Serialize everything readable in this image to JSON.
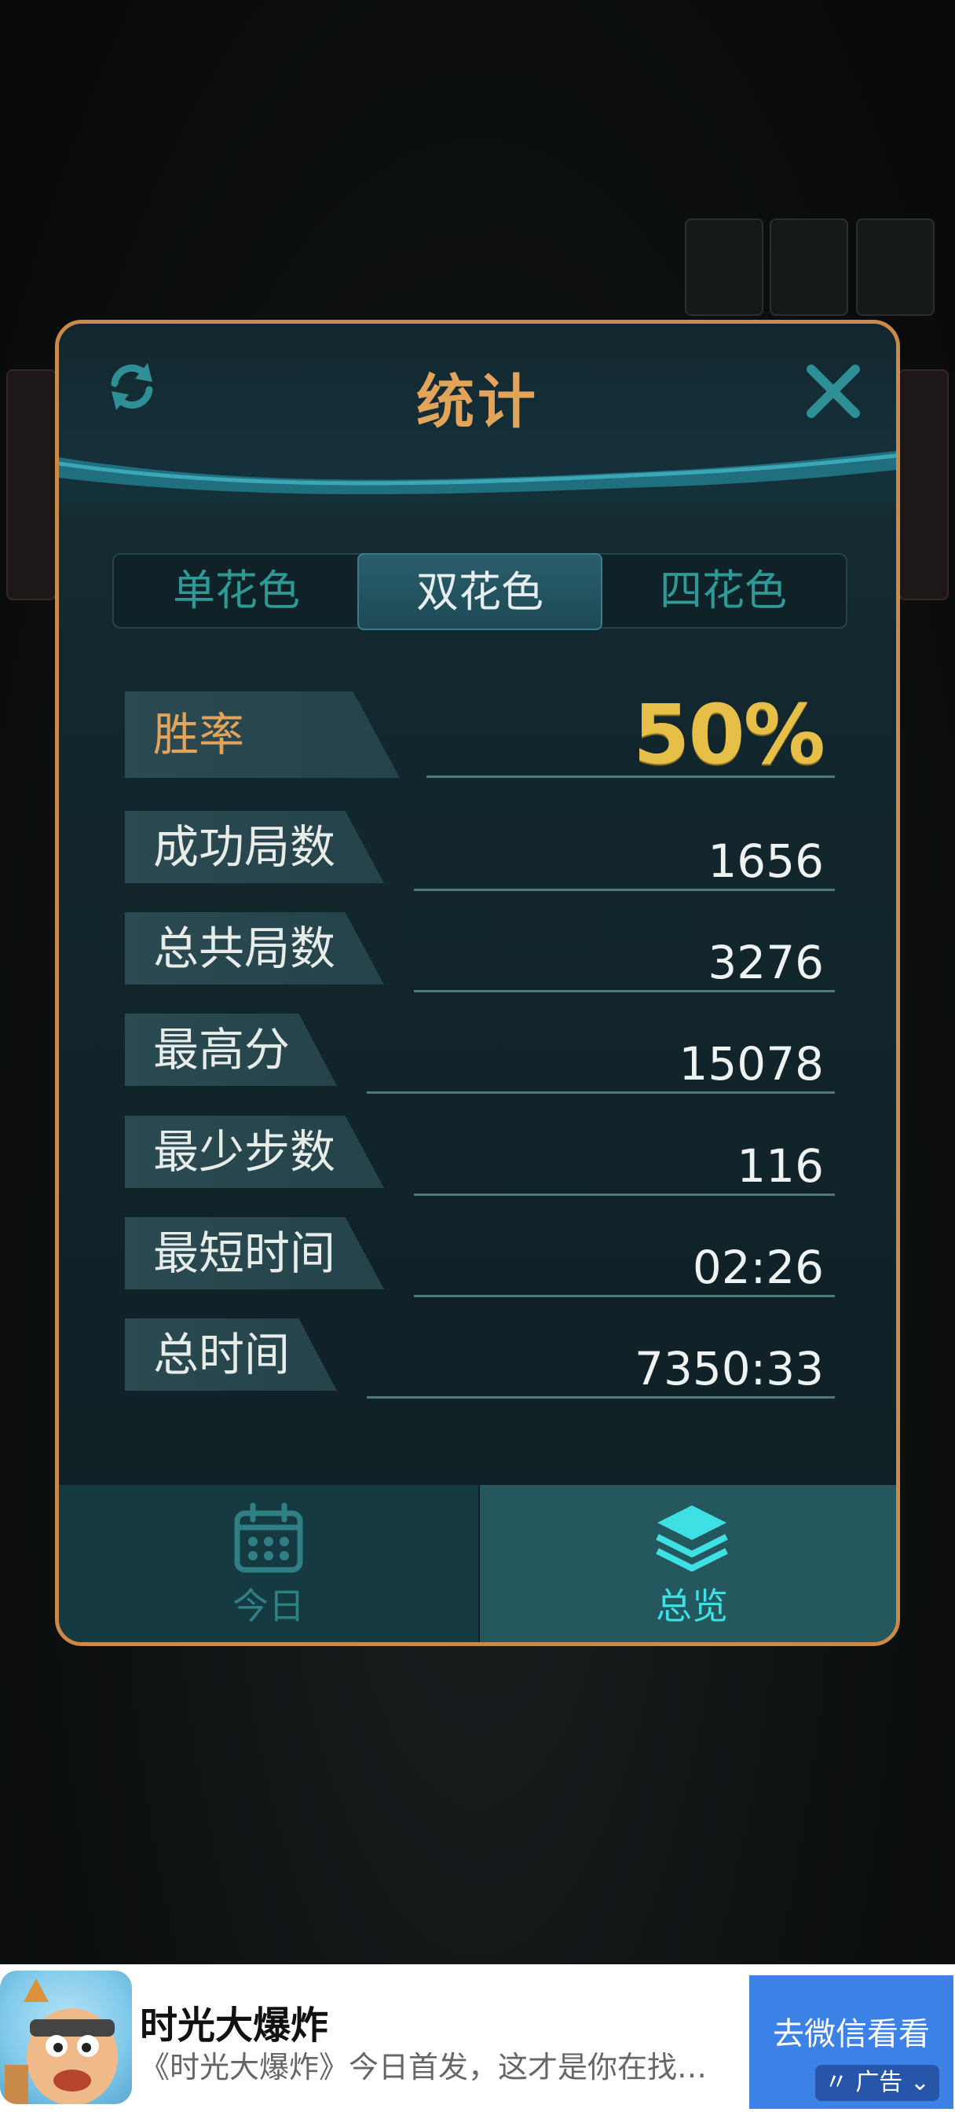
{
  "dialog": {
    "title": "统计",
    "tabs": [
      {
        "label": "单花色",
        "selected": false
      },
      {
        "label": "双花色",
        "selected": true
      },
      {
        "label": "四花色",
        "selected": false
      }
    ],
    "stats": [
      {
        "label": "胜率",
        "value": "50%"
      },
      {
        "label": "成功局数",
        "value": "1656"
      },
      {
        "label": "总共局数",
        "value": "3276"
      },
      {
        "label": "最高分",
        "value": "15078"
      },
      {
        "label": "最少步数",
        "value": "116"
      },
      {
        "label": "最短时间",
        "value": "02:26"
      },
      {
        "label": "总时间",
        "value": "7350:33"
      }
    ],
    "bottom_tabs": [
      {
        "label": "今日",
        "icon": "calendar-icon",
        "selected": false
      },
      {
        "label": "总览",
        "icon": "layers-icon",
        "selected": true
      }
    ],
    "colors": {
      "accent": "#e2a35b",
      "border": "#c98a4a",
      "win_value": "#e6bf48",
      "tab_active": "#3fe0e4"
    }
  },
  "ad": {
    "title": "时光大爆炸",
    "description": "《时光大爆炸》今日首发，这才是你在找…",
    "cta": "去微信看看",
    "badge": "广告"
  }
}
